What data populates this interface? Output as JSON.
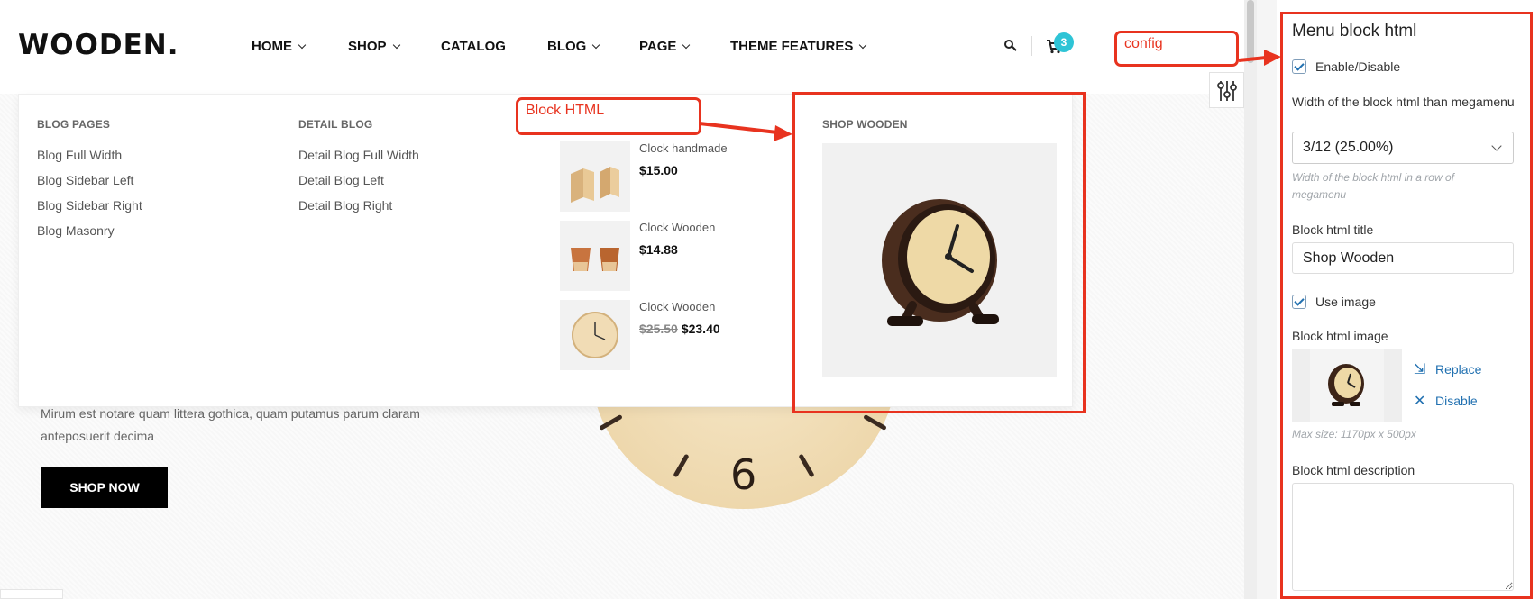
{
  "header": {
    "logo": "WOODEN.",
    "nav": [
      {
        "label": "HOME",
        "has_dropdown": true
      },
      {
        "label": "SHOP",
        "has_dropdown": true
      },
      {
        "label": "CATALOG",
        "has_dropdown": false
      },
      {
        "label": "BLOG",
        "has_dropdown": true
      },
      {
        "label": "PAGE",
        "has_dropdown": true
      },
      {
        "label": "THEME FEATURES",
        "has_dropdown": true
      }
    ],
    "cart_count": "3"
  },
  "megamenu": {
    "blog_pages": {
      "title": "BLOG PAGES",
      "links": [
        "Blog Full Width",
        "Blog Sidebar Left",
        "Blog Sidebar Right",
        "Blog Masonry"
      ]
    },
    "detail_blog": {
      "title": "DETAIL BLOG",
      "links": [
        "Detail Blog Full Width",
        "Detail Blog Left",
        "Detail Blog Right"
      ]
    },
    "products": [
      {
        "name": "Clock handmade",
        "price": "$15.00",
        "old_price": ""
      },
      {
        "name": "Clock Wooden",
        "price": "$14.88",
        "old_price": ""
      },
      {
        "name": "Clock Wooden",
        "price": "$23.40",
        "old_price": "$25.50"
      }
    ],
    "block_html": {
      "title": "SHOP WOODEN"
    }
  },
  "hero": {
    "text": "Mirum est notare quam littera gothica, quam putamus parum claram anteposuerit decima",
    "button": "SHOP NOW"
  },
  "panel": {
    "title": "Menu block html",
    "enable_label": "Enable/Disable",
    "width_label": "Width of the block html than megamenu",
    "width_value": "3/12 (25.00%)",
    "width_hint": "Width of the block html in a row of megamenu",
    "title_label": "Block html title",
    "title_value": "Shop Wooden",
    "use_image_label": "Use image",
    "image_label": "Block html image",
    "replace_label": "Replace",
    "disable_label": "Disable",
    "image_hint": "Max size: 1170px x 500px",
    "description_label": "Block html description"
  },
  "annotations": {
    "config": "config",
    "block_html": "Block HTML",
    "color": "#e8331f"
  }
}
